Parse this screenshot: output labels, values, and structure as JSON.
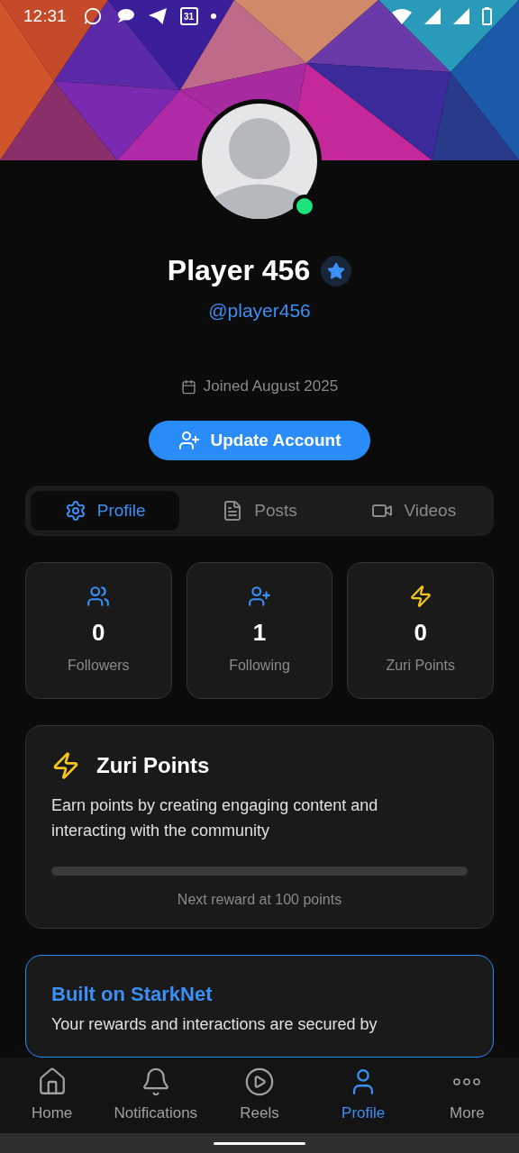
{
  "status_bar": {
    "time": "12:31",
    "calendar_day": "31"
  },
  "profile": {
    "name": "Player 456",
    "verified": true,
    "handle": "@player456",
    "online": true,
    "joined": "Joined August 2025",
    "update_button": "Update Account"
  },
  "tabs": [
    {
      "label": "Profile",
      "selected": true
    },
    {
      "label": "Posts",
      "selected": false
    },
    {
      "label": "Videos",
      "selected": false
    }
  ],
  "stats": [
    {
      "value": "0",
      "label": "Followers",
      "color": "#3b8ff5"
    },
    {
      "value": "1",
      "label": "Following",
      "color": "#3b8ff5"
    },
    {
      "value": "0",
      "label": "Zuri Points",
      "color": "#f5c518"
    }
  ],
  "points_card": {
    "title": "Zuri Points",
    "description": "Earn points by creating engaging content and interacting with the community",
    "next_reward": "Next reward at 100 points"
  },
  "starknet_card": {
    "title": "Built on StarkNet",
    "description": "Your rewards and interactions are secured by"
  },
  "bottom_nav": [
    {
      "label": "Home",
      "selected": false
    },
    {
      "label": "Notifications",
      "selected": false
    },
    {
      "label": "Reels",
      "selected": false
    },
    {
      "label": "Profile",
      "selected": true
    },
    {
      "label": "More",
      "selected": false
    }
  ]
}
